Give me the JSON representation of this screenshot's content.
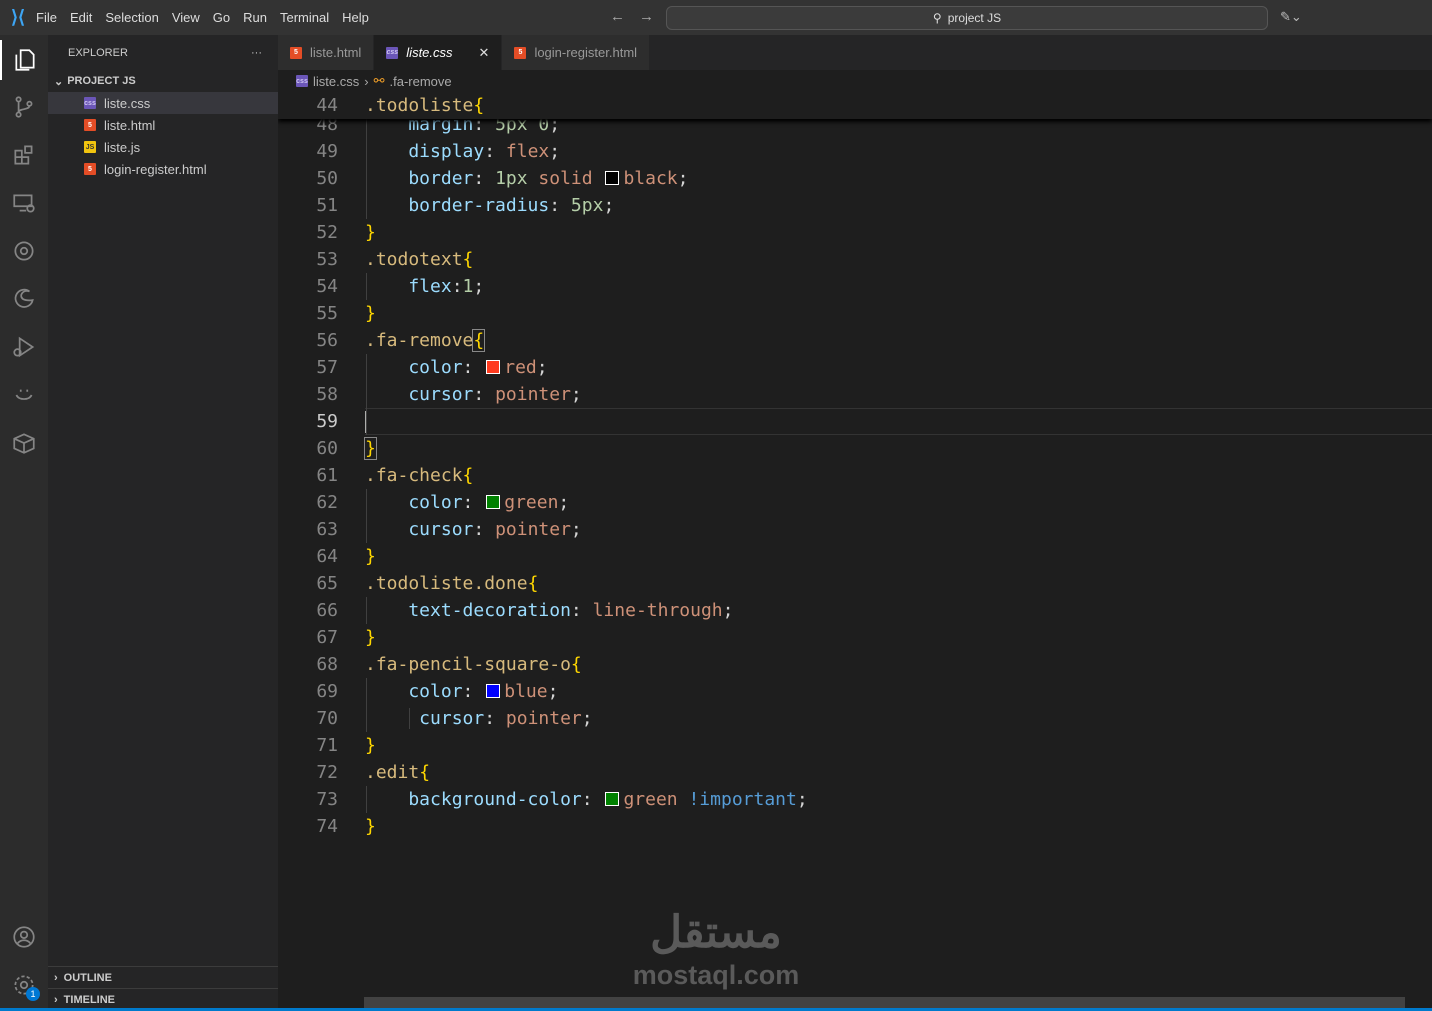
{
  "titlebar": {
    "menu": [
      "File",
      "Edit",
      "Selection",
      "View",
      "Go",
      "Run",
      "Terminal",
      "Help"
    ],
    "search": "project JS"
  },
  "sidebar": {
    "title": "EXPLORER",
    "more": "···",
    "project": "PROJECT JS",
    "files": [
      {
        "name": "liste.css",
        "type": "css",
        "selected": true
      },
      {
        "name": "liste.html",
        "type": "html"
      },
      {
        "name": "liste.js",
        "type": "js"
      },
      {
        "name": "login-register.html",
        "type": "html"
      }
    ],
    "outline": "OUTLINE",
    "timeline": "TIMELINE"
  },
  "activity": {
    "settings_badge": "1"
  },
  "tabs": [
    {
      "label": "liste.html",
      "type": "html"
    },
    {
      "label": "liste.css",
      "type": "css",
      "active": true
    },
    {
      "label": "login-register.html",
      "type": "html"
    }
  ],
  "breadcrumb": {
    "file": "liste.css",
    "symbol": ".fa-remove"
  },
  "sticky": {
    "num": "44",
    "tokens": [
      [
        "sel",
        ".todoliste"
      ],
      [
        "brace",
        "{"
      ]
    ]
  },
  "lines": [
    {
      "num": "48",
      "tokens": [
        [
          "prop",
          "    margin"
        ],
        [
          "punct",
          ": "
        ],
        [
          "num",
          "5px 0"
        ],
        [
          "punct",
          ";"
        ]
      ]
    },
    {
      "num": "49",
      "tokens": [
        [
          "prop",
          "    display"
        ],
        [
          "punct",
          ": "
        ],
        [
          "val",
          "flex"
        ],
        [
          "punct",
          ";"
        ]
      ]
    },
    {
      "num": "50",
      "tokens": [
        [
          "prop",
          "    border"
        ],
        [
          "punct",
          ": "
        ],
        [
          "num",
          "1px "
        ],
        [
          "val",
          "solid "
        ],
        [
          "swatch",
          "#000000"
        ],
        [
          "val",
          "black"
        ],
        [
          "punct",
          ";"
        ]
      ]
    },
    {
      "num": "51",
      "tokens": [
        [
          "prop",
          "    border-radius"
        ],
        [
          "punct",
          ": "
        ],
        [
          "num",
          "5px"
        ],
        [
          "punct",
          ";"
        ]
      ]
    },
    {
      "num": "52",
      "tokens": [
        [
          "brace",
          "}"
        ]
      ]
    },
    {
      "num": "53",
      "tokens": [
        [
          "sel",
          ".todotext"
        ],
        [
          "brace",
          "{"
        ]
      ]
    },
    {
      "num": "54",
      "tokens": [
        [
          "prop",
          "    flex"
        ],
        [
          "punct",
          ":"
        ],
        [
          "num",
          "1"
        ],
        [
          "punct",
          ";"
        ]
      ]
    },
    {
      "num": "55",
      "tokens": [
        [
          "brace",
          "}"
        ]
      ]
    },
    {
      "num": "56",
      "tokens": [
        [
          "sel",
          ".fa-remove"
        ],
        [
          "brace",
          "{"
        ]
      ]
    },
    {
      "num": "57",
      "tokens": [
        [
          "prop",
          "    color"
        ],
        [
          "punct",
          ": "
        ],
        [
          "swatch",
          "#ff3b1f"
        ],
        [
          "val",
          "red"
        ],
        [
          "punct",
          ";"
        ]
      ]
    },
    {
      "num": "58",
      "tokens": [
        [
          "prop",
          "    cursor"
        ],
        [
          "punct",
          ": "
        ],
        [
          "val",
          "pointer"
        ],
        [
          "punct",
          ";"
        ]
      ]
    },
    {
      "num": "59",
      "tokens": [],
      "current": true
    },
    {
      "num": "60",
      "tokens": [
        [
          "brace",
          "}"
        ]
      ]
    },
    {
      "num": "61",
      "tokens": [
        [
          "sel",
          ".fa-check"
        ],
        [
          "brace",
          "{"
        ]
      ]
    },
    {
      "num": "62",
      "tokens": [
        [
          "prop",
          "    color"
        ],
        [
          "punct",
          ": "
        ],
        [
          "swatch",
          "#008000"
        ],
        [
          "val",
          "green"
        ],
        [
          "punct",
          ";"
        ]
      ]
    },
    {
      "num": "63",
      "tokens": [
        [
          "prop",
          "    cursor"
        ],
        [
          "punct",
          ": "
        ],
        [
          "val",
          "pointer"
        ],
        [
          "punct",
          ";"
        ]
      ]
    },
    {
      "num": "64",
      "tokens": [
        [
          "brace",
          "}"
        ]
      ]
    },
    {
      "num": "65",
      "tokens": [
        [
          "sel",
          ".todoliste.done"
        ],
        [
          "brace",
          "{"
        ]
      ]
    },
    {
      "num": "66",
      "tokens": [
        [
          "prop",
          "    text-decoration"
        ],
        [
          "punct",
          ": "
        ],
        [
          "val",
          "line-through"
        ],
        [
          "punct",
          ";"
        ]
      ]
    },
    {
      "num": "67",
      "tokens": [
        [
          "brace",
          "}"
        ]
      ]
    },
    {
      "num": "68",
      "tokens": [
        [
          "sel",
          ".fa-pencil-square-o"
        ],
        [
          "brace",
          "{"
        ]
      ]
    },
    {
      "num": "69",
      "tokens": [
        [
          "prop",
          "    color"
        ],
        [
          "punct",
          ": "
        ],
        [
          "swatch",
          "#0000ff"
        ],
        [
          "val",
          "blue"
        ],
        [
          "punct",
          ";"
        ]
      ]
    },
    {
      "num": "70",
      "tokens": [
        [
          "prop",
          "     cursor"
        ],
        [
          "punct",
          ": "
        ],
        [
          "val",
          "pointer"
        ],
        [
          "punct",
          ";"
        ]
      ]
    },
    {
      "num": "71",
      "tokens": [
        [
          "brace",
          "}"
        ]
      ]
    },
    {
      "num": "72",
      "tokens": [
        [
          "sel",
          ".edit"
        ],
        [
          "brace",
          "{"
        ]
      ]
    },
    {
      "num": "73",
      "tokens": [
        [
          "prop",
          "    background-color"
        ],
        [
          "punct",
          ": "
        ],
        [
          "swatch",
          "#008000"
        ],
        [
          "val",
          "green "
        ],
        [
          "imp",
          "!important"
        ],
        [
          "punct",
          ";"
        ]
      ]
    },
    {
      "num": "74",
      "tokens": [
        [
          "brace",
          "}"
        ]
      ]
    }
  ],
  "watermark": {
    "arabic": "مستقل",
    "latin": "mostaql.com"
  }
}
